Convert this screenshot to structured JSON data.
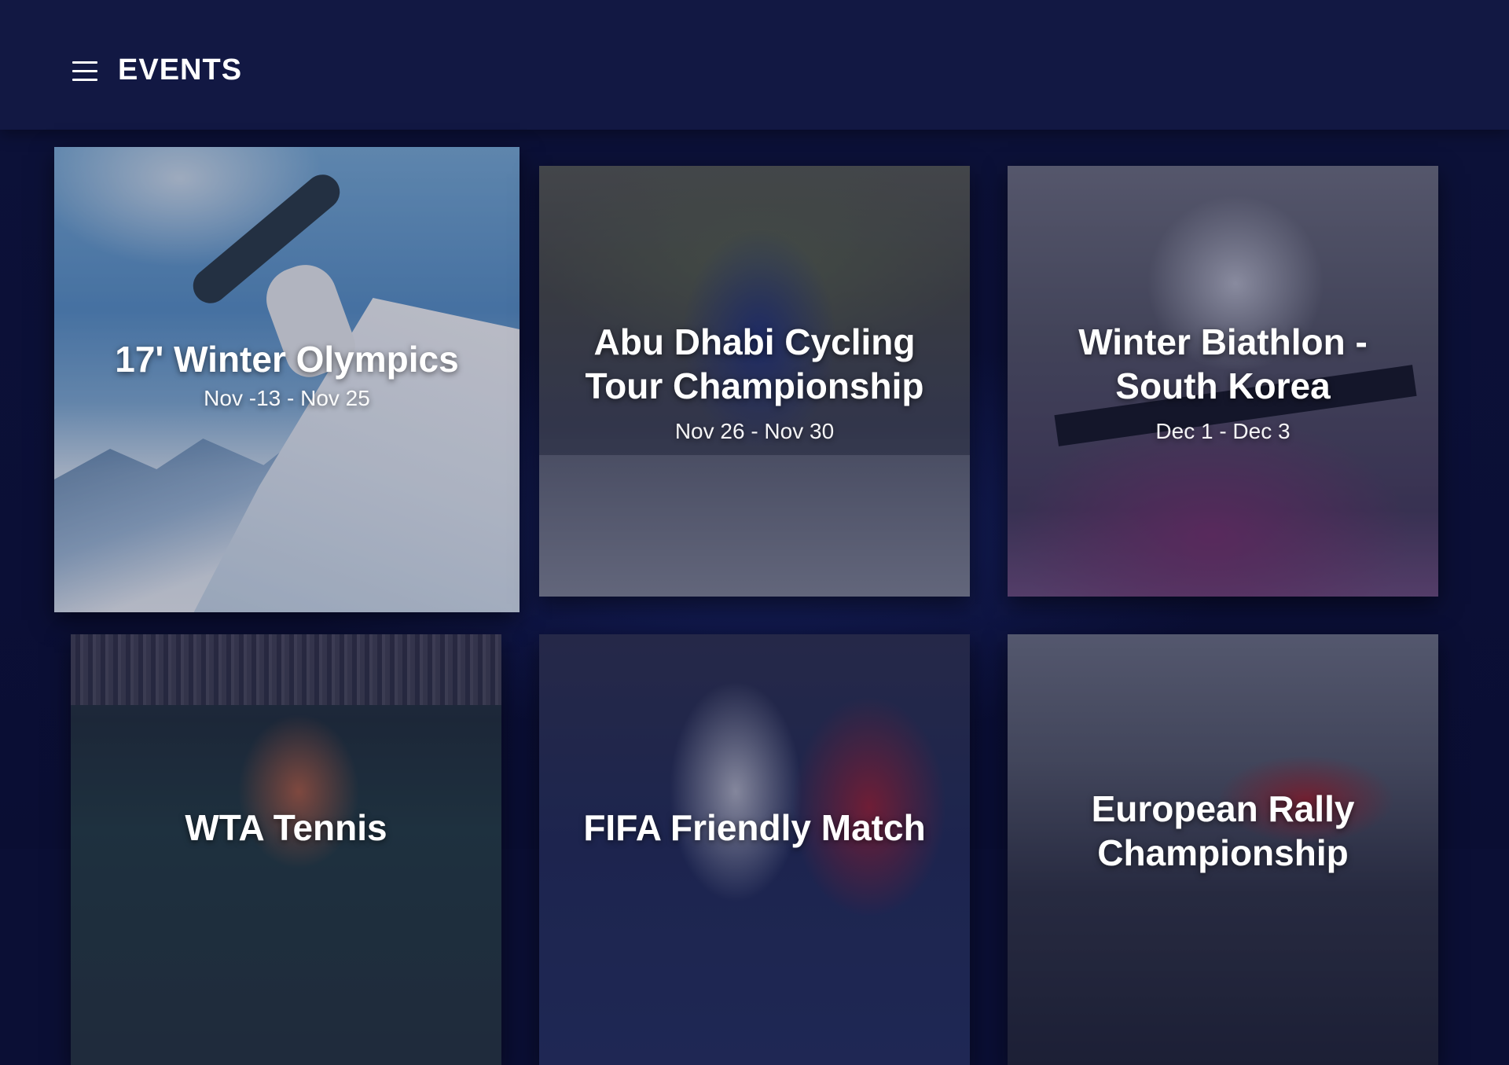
{
  "header": {
    "title": "EVENTS"
  },
  "icons": {
    "menu": "hamburger-menu-icon"
  },
  "events": [
    {
      "title": "17' Winter Olympics",
      "dates": "Nov -13 - Nov 25",
      "focused": true
    },
    {
      "title": "Abu Dhabi Cycling Tour Championship",
      "dates": "Nov 26 - Nov 30"
    },
    {
      "title": "Winter Biathlon - South Korea",
      "dates": "Dec 1 - Dec 3"
    },
    {
      "title": "WTA Tennis",
      "dates": ""
    },
    {
      "title": "FIFA Friendly Match",
      "dates": ""
    },
    {
      "title": "European Rally Championship",
      "dates": ""
    }
  ],
  "colors": {
    "background": "#0b0f35",
    "topbar": "#121843",
    "text": "#ffffff"
  }
}
